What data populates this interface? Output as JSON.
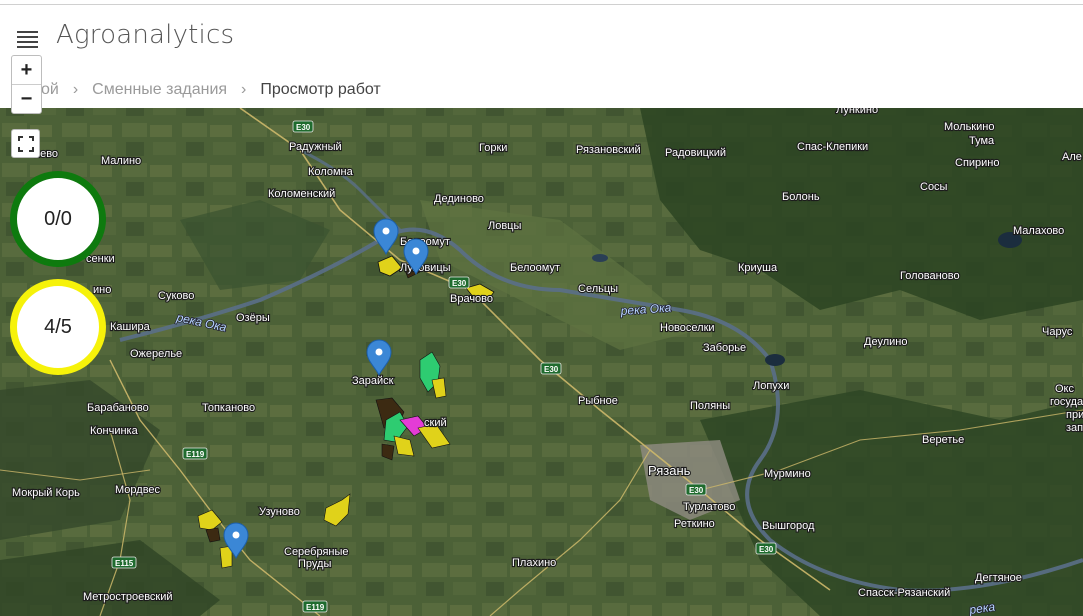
{
  "app": {
    "title": "Agroanalytics"
  },
  "breadcrumb": {
    "items": [
      "мой",
      "Сменные задания"
    ],
    "current": "Просмотр работ"
  },
  "map_controls": {
    "zoom_in": "+",
    "zoom_out": "−"
  },
  "counters": {
    "green": "0/0",
    "yellow": "4/5"
  },
  "colors": {
    "green_ring": "#0e7a0e",
    "yellow_ring": "#f6f20a",
    "marker": "#3b87d6"
  },
  "map_labels": {
    "malino": "Малино",
    "novo": "нево",
    "raduzhny": "Радужный",
    "kolomna": "Коломна",
    "kolomensky": "Коломенский",
    "gorki": "Горки",
    "ryazanovsky": "Рязановский",
    "radovitsky": "Радовицкий",
    "spas_klepiki": "Спас-Клепики",
    "lunkino": "Лункино",
    "molkino": "Молькино",
    "tuma": "Тума",
    "ale": "Але",
    "spirino": "Спирино",
    "sosy": "Сосы",
    "bolon": "Болонь",
    "dedinovo": "Дединово",
    "lovtsy": "Ловцы",
    "beloomut1": "Белоомут",
    "beloomut2": "Белоомут",
    "lukhovitsy": "Луховицы",
    "malakhovo": "Малахово",
    "senki": "сенки",
    "krusha": "Криуша",
    "golovanovo": "Голованово",
    "selcy": "Сельцы",
    "vrachovo": "Врачово",
    "suhovo": "Суково",
    "kashira": "Кашира",
    "ozyory": "Озёры",
    "ino": "ино",
    "novoselki": "Новоселки",
    "zaborye": "Заборье",
    "charus": "Чарус",
    "deulino": "Деулино",
    "ozherelye": "Ожерелье",
    "zaraysk": "Зарайск",
    "skiy": "ский",
    "lopukhi": "Лопухи",
    "rybnoe": "Рыбное",
    "polyany": "Поляны",
    "baranovo": "Барабаново",
    "topkanovo": "Топканово",
    "konchinka": "Кончинка",
    "veretye": "Веретье",
    "ryazan": "Рязань",
    "murmino": "Мурмино",
    "mokry_kor": "Мокрый Корь",
    "mordves": "Мордвес",
    "turlatovo": "Турлатово",
    "uznovo": "Узуново",
    "retkino": "Реткино",
    "vyshgorod": "Вышгород",
    "serebryanye": "Серебряные",
    "prudy": "Пруды",
    "plakhino": "Плахино",
    "metrostroyevsky": "Метростроевский",
    "spassk": "Спасск-Рязанский",
    "degtyanoe": "Дегтяное",
    "oks": "Окс",
    "gosudarst": "государст",
    "prirod": "природ",
    "zapoved": "заповед",
    "reka_oka_1": "река Ока",
    "reka_oka_2": "река Ока",
    "reka": "река"
  },
  "road_shields": {
    "e30_a": "E30",
    "e30_b": "E30",
    "e30_c": "E30",
    "e30_d": "E30",
    "e30_e": "E30",
    "e119_a": "E119",
    "e115": "E115",
    "e119_b": "E119"
  }
}
